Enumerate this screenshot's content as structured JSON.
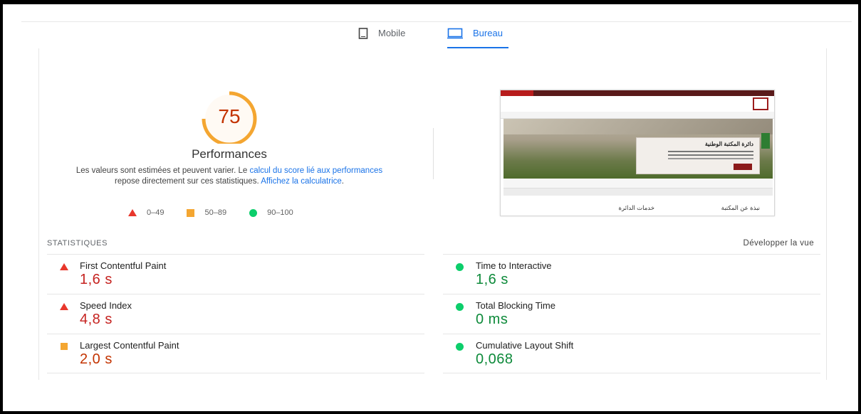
{
  "tabs": {
    "mobile_label": "Mobile",
    "desktop_label": "Bureau",
    "active": "Bureau"
  },
  "score": {
    "value": "75",
    "fraction": 0.75,
    "title": "Performances",
    "color": "#f4a631",
    "text_color": "#c33300"
  },
  "description": {
    "part1": "Les valeurs sont estimées et peuvent varier. Le ",
    "link1": "calcul du score lié aux performances",
    "part2": " repose directement sur ces statistiques. ",
    "link2": "Affichez la calculatrice",
    "part3": "."
  },
  "legend": {
    "fail": "0–49",
    "average": "50–89",
    "pass": "90–100"
  },
  "screenshot": {
    "hero_box_title": "دائرة المكتبة الوطنية",
    "bottom_left": "خدمات الدائرة",
    "bottom_right": "نبذة عن المكتبة"
  },
  "stats": {
    "title": "STATISTIQUES",
    "expand_label": "Développer la vue",
    "left": [
      {
        "label": "First Contentful Paint",
        "value": "1,6 s",
        "status": "fail"
      },
      {
        "label": "Speed Index",
        "value": "4,8 s",
        "status": "fail"
      },
      {
        "label": "Largest Contentful Paint",
        "value": "2,0 s",
        "status": "average"
      }
    ],
    "right": [
      {
        "label": "Time to Interactive",
        "value": "1,6 s",
        "status": "pass"
      },
      {
        "label": "Total Blocking Time",
        "value": "0 ms",
        "status": "pass"
      },
      {
        "label": "Cumulative Layout Shift",
        "value": "0,068",
        "status": "pass"
      }
    ]
  },
  "colors": {
    "accent": "#1a73e8",
    "fail": "#e8372c",
    "average": "#f4a631",
    "pass": "#0cce6b"
  }
}
